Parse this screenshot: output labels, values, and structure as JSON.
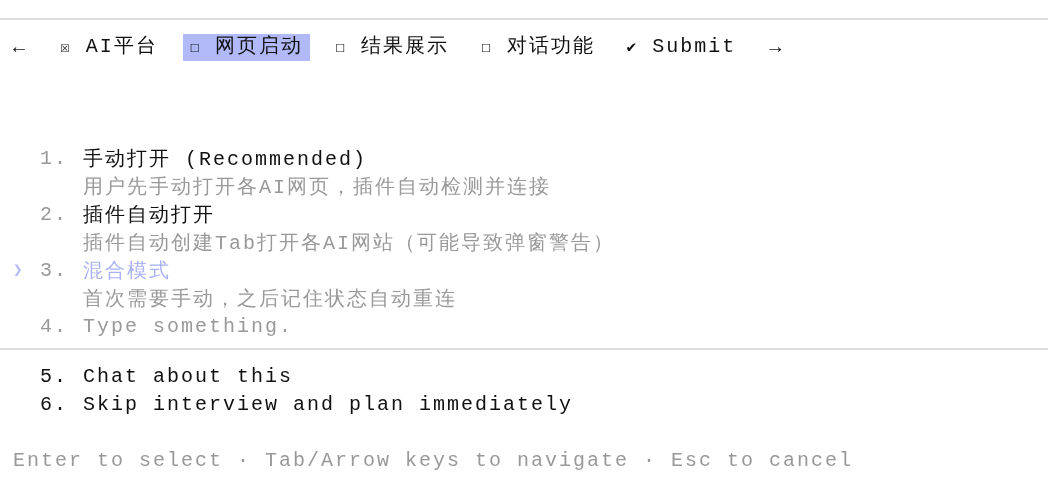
{
  "tab_bar": {
    "back_arrow": "←",
    "forward_arrow": "→",
    "tabs": [
      {
        "mark": "☒",
        "label": "AI平台",
        "selected": false
      },
      {
        "mark": "☐",
        "label": "网页启动",
        "selected": true
      },
      {
        "mark": "☐",
        "label": "结果展示",
        "selected": false
      },
      {
        "mark": "☐",
        "label": "对话功能",
        "selected": false
      },
      {
        "mark": "✔",
        "label": "Submit",
        "selected": false
      }
    ]
  },
  "cursor": "❯",
  "options": [
    {
      "kind": "option",
      "number": "1.",
      "label": "手动打开 (Recommended)",
      "description": "用户先手动打开各AI网页，插件自动检测并连接",
      "selected": false
    },
    {
      "kind": "option",
      "number": "2.",
      "label": "插件自动打开",
      "description": "插件自动创建Tab打开各AI网站（可能导致弹窗警告）",
      "selected": false
    },
    {
      "kind": "option",
      "number": "3.",
      "label": "混合模式",
      "description": "首次需要手动，之后记住状态自动重连",
      "selected": true
    },
    {
      "kind": "input",
      "number": "4.",
      "placeholder": "Type something.",
      "selected": false
    }
  ],
  "extra_options": [
    {
      "number": "5.",
      "label": "Chat about this"
    },
    {
      "number": "6.",
      "label": "Skip interview and plan immediately"
    }
  ],
  "footer": "Enter to select · Tab/Arrow keys to navigate · Esc to cancel"
}
